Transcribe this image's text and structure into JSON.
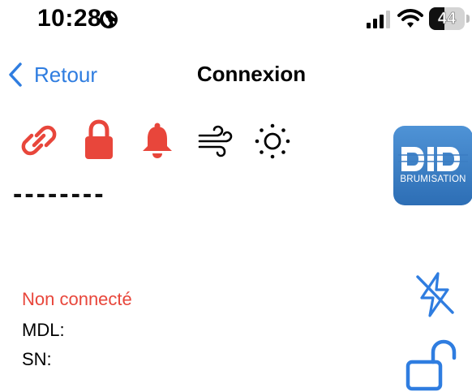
{
  "status_bar": {
    "time": "10:28",
    "battery_level": "44",
    "battery_fraction": 0.44
  },
  "nav": {
    "back_label": "Retour",
    "title": "Connexion"
  },
  "status_icons": [
    {
      "icon": "link-icon",
      "color": "#e8463b"
    },
    {
      "icon": "lock-icon",
      "color": "#e8463b"
    },
    {
      "icon": "bell-icon",
      "color": "#e8463b"
    },
    {
      "icon": "wind-icon",
      "color": "#000000"
    },
    {
      "icon": "sun-icon",
      "color": "#000000"
    }
  ],
  "readout": "--------",
  "logo": {
    "main": "DID",
    "subtitle": "BRUMISATION"
  },
  "device_info": {
    "connection_status": "Non connecté",
    "mdl_label": "MDL:",
    "sn_label": "SN:"
  },
  "actions": [
    {
      "icon": "bolt-slash-icon",
      "color": "#2f7de0"
    },
    {
      "icon": "unlock-icon",
      "color": "#2f7de0"
    }
  ],
  "colors": {
    "accent_blue": "#2f7de0",
    "alert_red": "#e8463b",
    "logo_blue": "#3a7fc6"
  }
}
